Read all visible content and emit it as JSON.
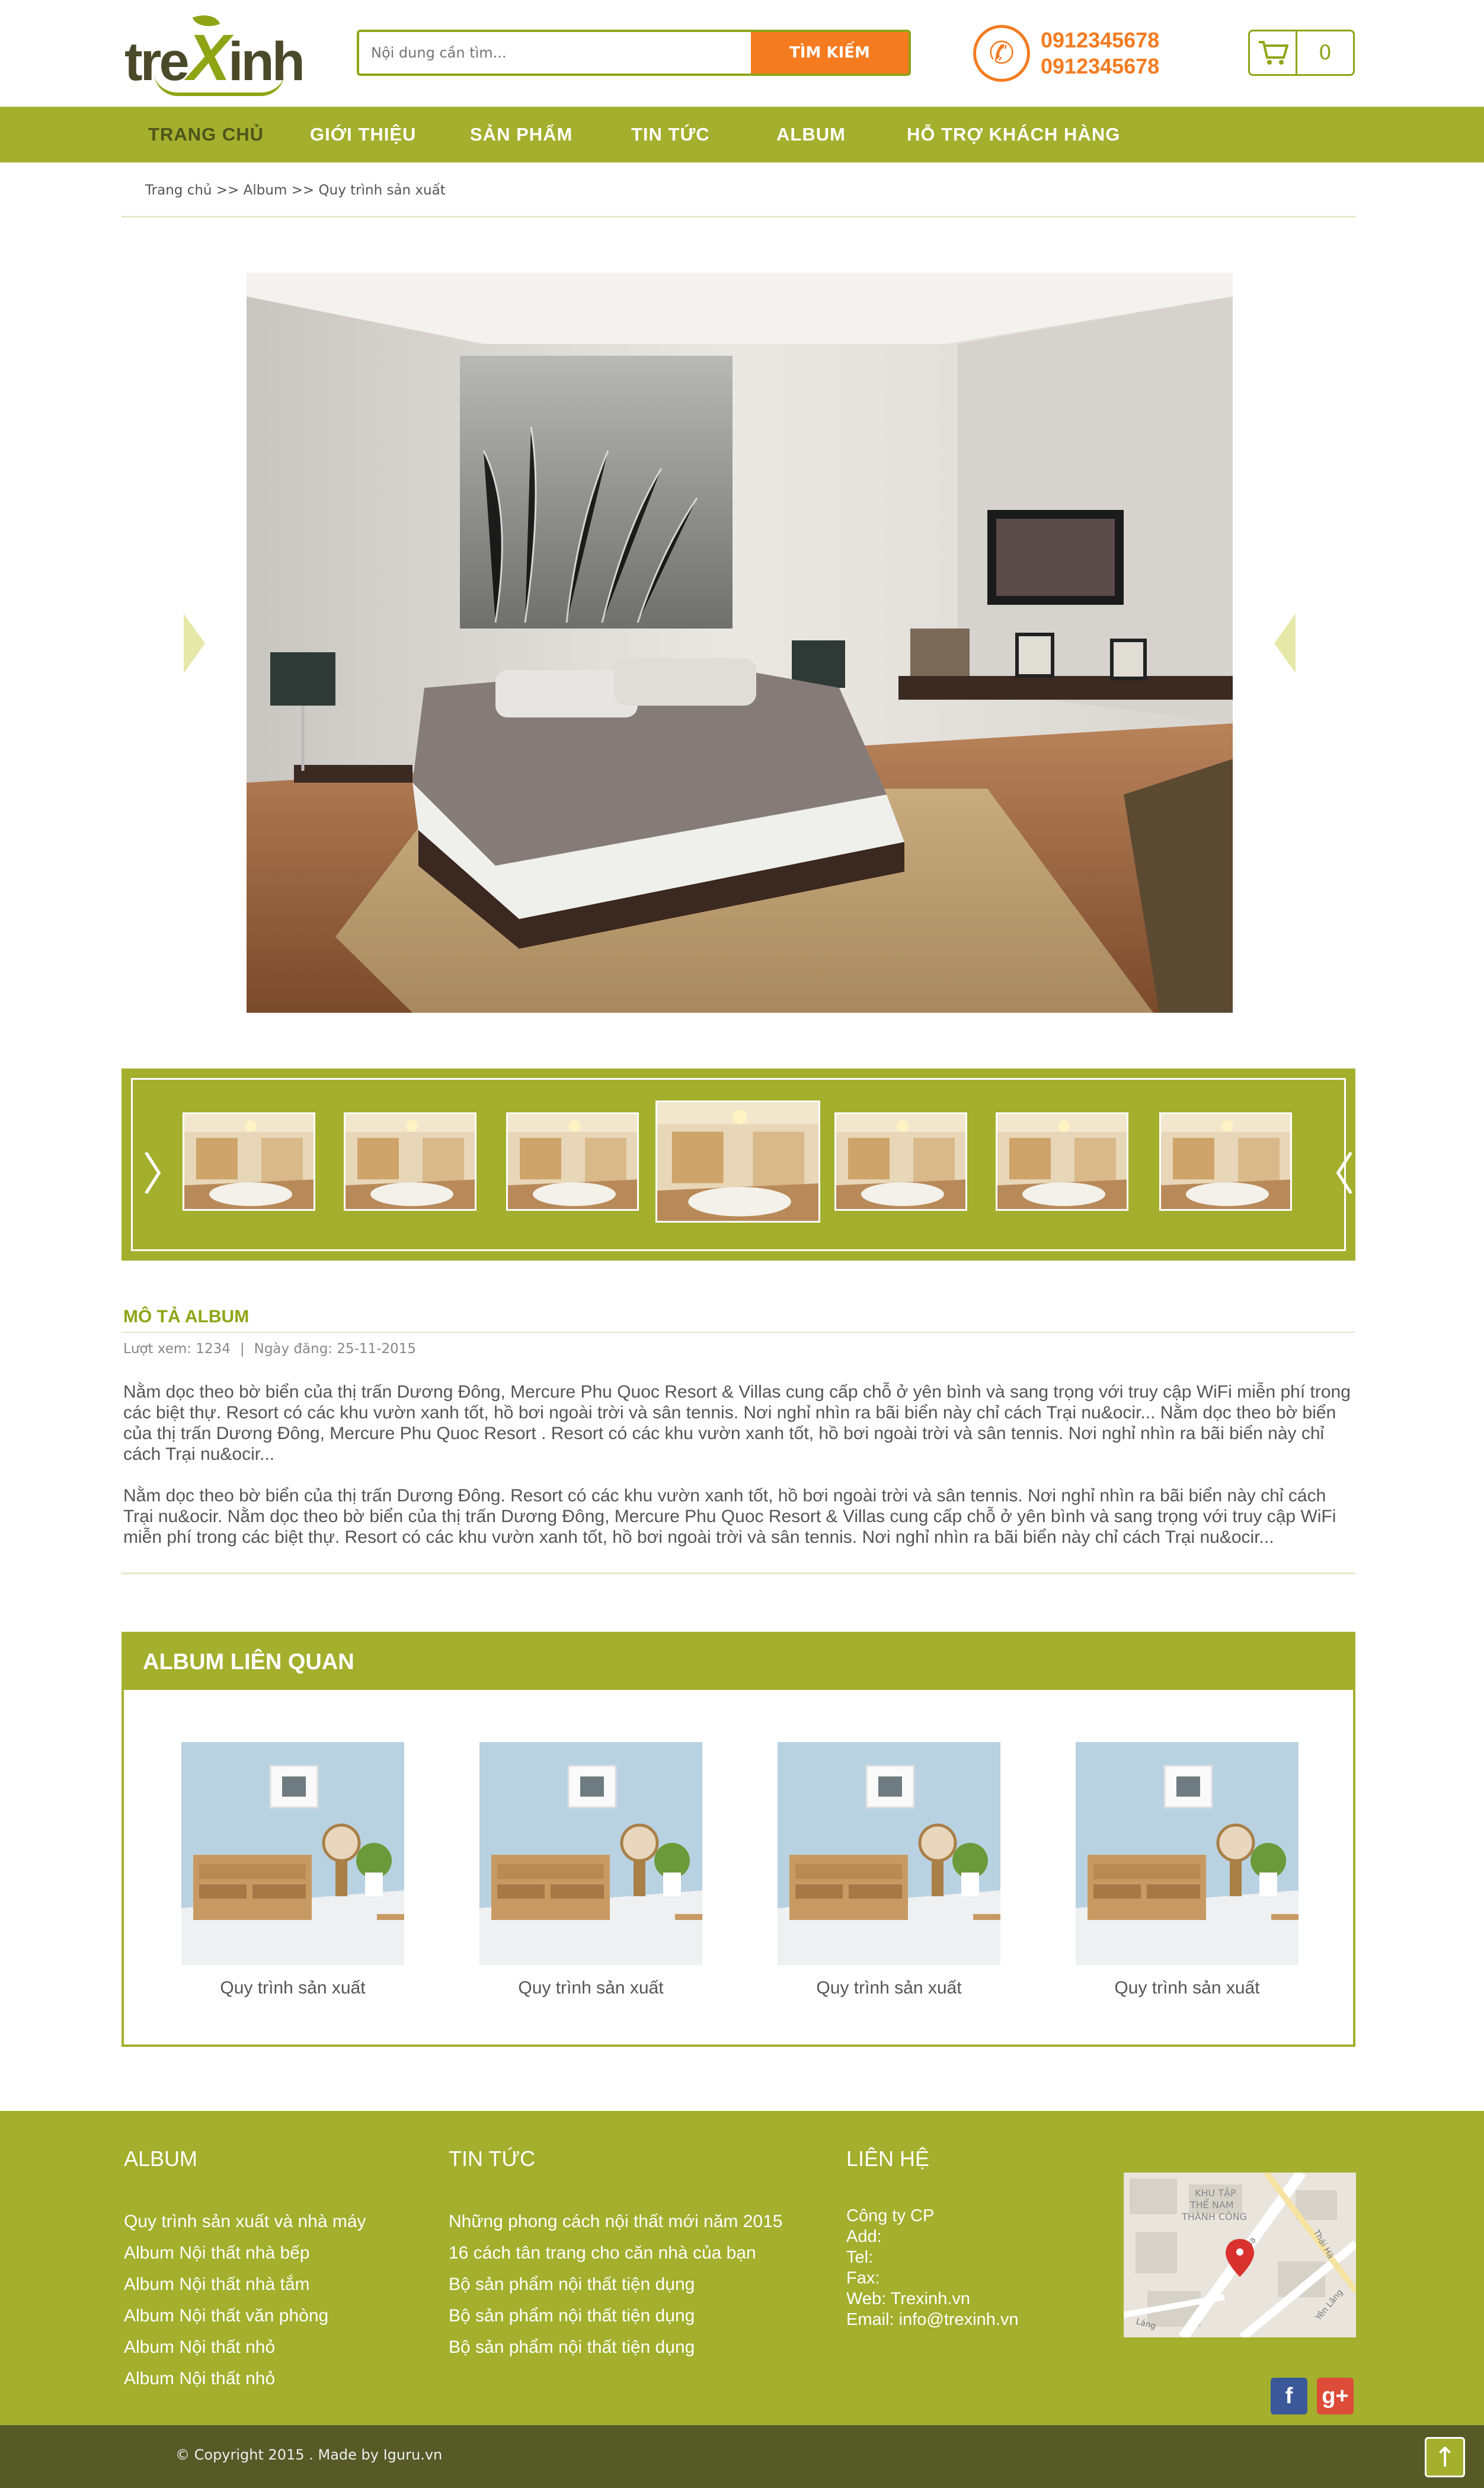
{
  "header": {
    "logo_text_part1": "tre",
    "logo_text_x": "X",
    "logo_text_part2": "inh",
    "search_placeholder": "Nội dung cần tìm...",
    "search_button": "TÌM KIẾM",
    "phone_1": "0912345678",
    "phone_2": "0912345678",
    "cart_count": "0"
  },
  "nav": {
    "items": [
      {
        "label": "TRANG CHỦ"
      },
      {
        "label": "GIỚI THIỆU"
      },
      {
        "label": "SẢN PHẨM"
      },
      {
        "label": "TIN TỨC"
      },
      {
        "label": "ALBUM"
      },
      {
        "label": "HỖ TRỢ KHÁCH HÀNG"
      }
    ]
  },
  "breadcrumb": "Trang chủ >> Album >> Quy trình sản xuất",
  "description": {
    "title": "MÔ TẢ ALBUM",
    "views": "Lượt xem: 1234",
    "date": "Ngày đăng: 25-11-2015",
    "paragraph_1": "Nằm dọc theo bờ biển của thị trấn Dương Đông, Mercure Phu Quoc Resort & Villas cung cấp chỗ ở yên bình và sang trọng với truy cập WiFi miễn phí trong các biệt thự. Resort có các khu vườn xanh tốt, hồ bơi ngoài trời và sân tennis. Nơi nghỉ nhìn ra bãi biển này chỉ cách Trại nu&ocir... Nằm dọc theo bờ biển của thị trấn Dương Đông, Mercure Phu Quoc Resort . Resort có các khu vườn xanh tốt, hồ bơi ngoài trời và sân tennis. Nơi nghỉ nhìn ra bãi biển này chỉ cách Trại nu&ocir...",
    "paragraph_2": "Nằm dọc theo bờ biển của thị trấn Dương Đông. Resort có các khu vườn xanh tốt, hồ bơi ngoài trời và sân tennis. Nơi nghỉ nhìn ra bãi biển này chỉ cách Trại nu&ocir. Nằm dọc theo bờ biển của thị trấn Dương Đông, Mercure Phu Quoc Resort & Villas cung cấp chỗ ở yên bình và sang trọng với truy cập WiFi miễn phí trong các biệt thự. Resort có các khu vườn xanh tốt, hồ bơi ngoài trời và sân tennis. Nơi nghỉ nhìn ra bãi biển này chỉ cách Trại nu&ocir..."
  },
  "related": {
    "title": "ALBUM LIÊN QUAN",
    "items": [
      {
        "caption": "Quy trình sản xuất"
      },
      {
        "caption": "Quy trình sản xuất"
      },
      {
        "caption": "Quy trình sản xuất"
      },
      {
        "caption": "Quy trình sản xuất"
      }
    ]
  },
  "footer": {
    "album_title": "ALBUM",
    "album_links": [
      "Quy trình sản xuất và nhà máy",
      "Album Nội thất nhà bếp",
      "Album Nội thất nhà tắm",
      "Album Nội thất văn phòng",
      "Album Nội thất nhỏ",
      "Album Nội thất nhỏ"
    ],
    "news_title": "TIN TỨC",
    "news_links": [
      "Những phong cách nội thất mới năm 2015",
      "16 cách tân trang cho căn nhà của bạn",
      "Bộ sản phẩm nội thất tiện dụng",
      "Bộ sản phẩm nội thất tiện dụng",
      "Bộ sản phẩm nội thất tiện dụng"
    ],
    "contact_title": "LIÊN HỆ",
    "contact_lines": [
      "Công ty CP",
      "Add:",
      "Tel:",
      "Fax:",
      "Web: Trexinh.vn",
      "Email: info@trexinh.vn"
    ],
    "map_labels": [
      "KHU TẬP",
      "THỂ NAM",
      "THÀNH CÔNG",
      "Láng Hạ",
      "Thái Hà",
      "Yên Lãng",
      "Láng"
    ],
    "facebook": "f",
    "googleplus": "g+",
    "copyright": "© Copyright 2015  .  Made by Iguru.vn"
  },
  "colors": {
    "brand_green": "#a3af2d",
    "brand_orange": "#f47b20",
    "dark_bar": "#555a27"
  }
}
